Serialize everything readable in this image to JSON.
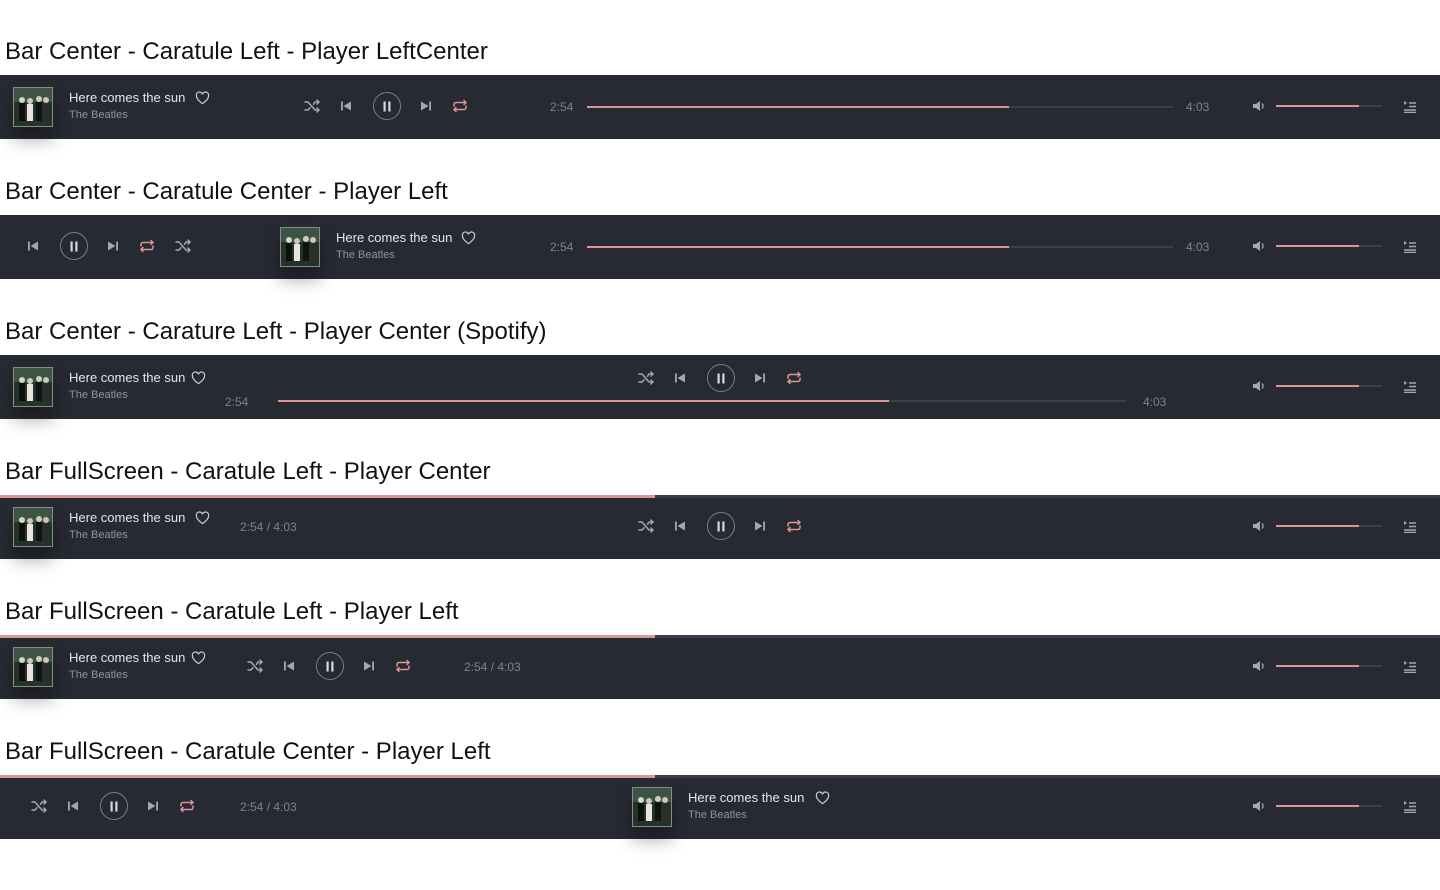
{
  "headings": [
    "Bar Center - Caratule Left - Player LeftCenter",
    "Bar Center - Caratule Center - Player Left",
    "Bar Center - Carature Left - Player Center (Spotify)",
    "Bar FullScreen - Caratule Left - Player Center",
    "Bar FullScreen - Caratule Left - Player Left",
    "Bar FullScreen - Caratule Center - Player Left"
  ],
  "track": {
    "title": "Here comes the sun",
    "artist": "The Beatles",
    "elapsed": "2:54",
    "duration": "4:03",
    "combined_time": "2:54 / 4:03",
    "progress_percent": 72,
    "favorite_icon": "heart-outline-icon"
  },
  "volume": {
    "level_percent": 78,
    "icon": "speaker-icon"
  },
  "controls": {
    "shuffle_icon": "shuffle-icon",
    "previous_icon": "skip-back-icon",
    "play_pause_icon": "pause-icon",
    "next_icon": "skip-forward-icon",
    "repeat_icon": "repeat-icon",
    "queue_icon": "queue-list-icon"
  },
  "colors": {
    "bar_background": "#272a32",
    "accent": "#dd9595",
    "track_background": "#3c3f47",
    "text_primary": "#e4e6ea",
    "text_secondary": "#8f939b"
  }
}
